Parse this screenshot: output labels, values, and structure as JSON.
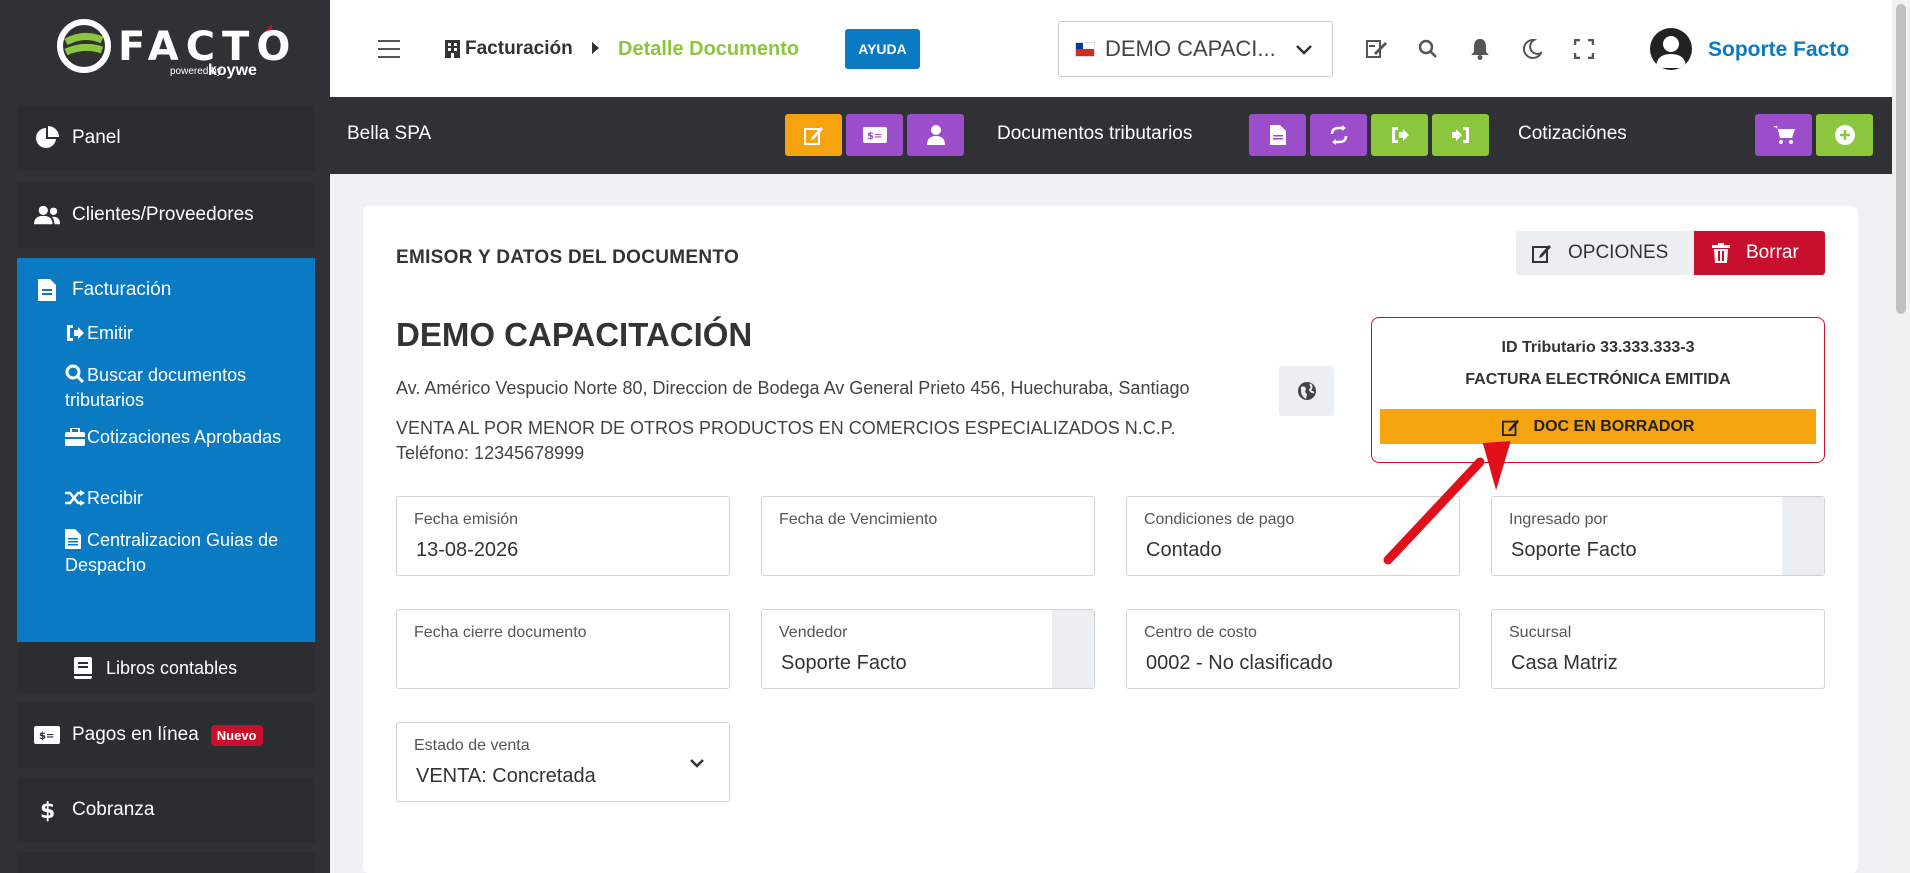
{
  "brand": {
    "logo": "FACTO",
    "powered": "powered by",
    "by": "koywe"
  },
  "sidebar": {
    "items": [
      {
        "label": "Panel",
        "icon": "pie-chart-icon"
      },
      {
        "label": "Clientes/Proveedores",
        "icon": "users-icon"
      }
    ],
    "group": {
      "label": "Facturación",
      "icon": "file-icon",
      "subitems": [
        {
          "label": "Emitir",
          "icon": "sign-out-icon"
        },
        {
          "label": "Buscar documentos tributarios",
          "icon": "search-icon"
        },
        {
          "label": "Cotizaciones Aprobadas",
          "icon": "briefcase-icon"
        },
        {
          "label": "Recibir",
          "icon": "shuffle-icon"
        },
        {
          "label": "Centralizacion Guias de Despacho",
          "icon": "file-text-icon"
        }
      ]
    },
    "books": "Libros contables",
    "payments": {
      "label": "Pagos en línea",
      "badge": "Nuevo"
    },
    "collection": "Cobranza"
  },
  "header": {
    "breadcrumb_root": "Facturación",
    "breadcrumb_current": "Detalle Documento",
    "help": "AYUDA",
    "company_select": "DEMO CAPACI...",
    "user": "Soporte Facto"
  },
  "actionbar": {
    "client": "Bella SPA",
    "docs_label": "Documentos tributarios",
    "quotes_label": "Cotizaciónes"
  },
  "card": {
    "title": "EMISOR Y DATOS DEL DOCUMENTO",
    "options": "OPCIONES",
    "delete": "Borrar",
    "company": "DEMO CAPACITACIÓN",
    "address": "Av. Américo Vespucio Norte 80, Direccion de Bodega Av General Prieto 456, Huechuraba, Santiago",
    "activity": "VENTA AL POR MENOR DE OTROS PRODUCTOS EN COMERCIOS ESPECIALIZADOS N.C.P.",
    "phone": "Teléfono: 12345678999",
    "tax_id": "ID Tributario 33.333.333-3",
    "doc_type": "FACTURA ELECTRÓNICA EMITIDA",
    "doc_status": "DOC EN BORRADOR"
  },
  "fields": {
    "issue_date": {
      "label": "Fecha emisión",
      "value": "13-08-2026"
    },
    "due_date": {
      "label": "Fecha de Vencimiento",
      "value": ""
    },
    "payment_terms": {
      "label": "Condiciones de pago",
      "value": "Contado"
    },
    "entered_by": {
      "label": "Ingresado por",
      "value": "Soporte Facto"
    },
    "close_date": {
      "label": "Fecha cierre documento",
      "value": ""
    },
    "seller": {
      "label": "Vendedor",
      "value": "Soporte Facto"
    },
    "cost_center": {
      "label": "Centro de costo",
      "value": "0002 - No clasificado"
    },
    "branch": {
      "label": "Sucursal",
      "value": "Casa Matriz"
    },
    "sale_status": {
      "label": "Estado de venta",
      "value": "VENTA: Concretada"
    }
  },
  "colors": {
    "primary": "#0a7bc3",
    "accent_green": "#8cc63f",
    "orange": "#f5a30f",
    "purple": "#9b4dca",
    "danger": "#c8102e",
    "dark": "#2f3134"
  }
}
